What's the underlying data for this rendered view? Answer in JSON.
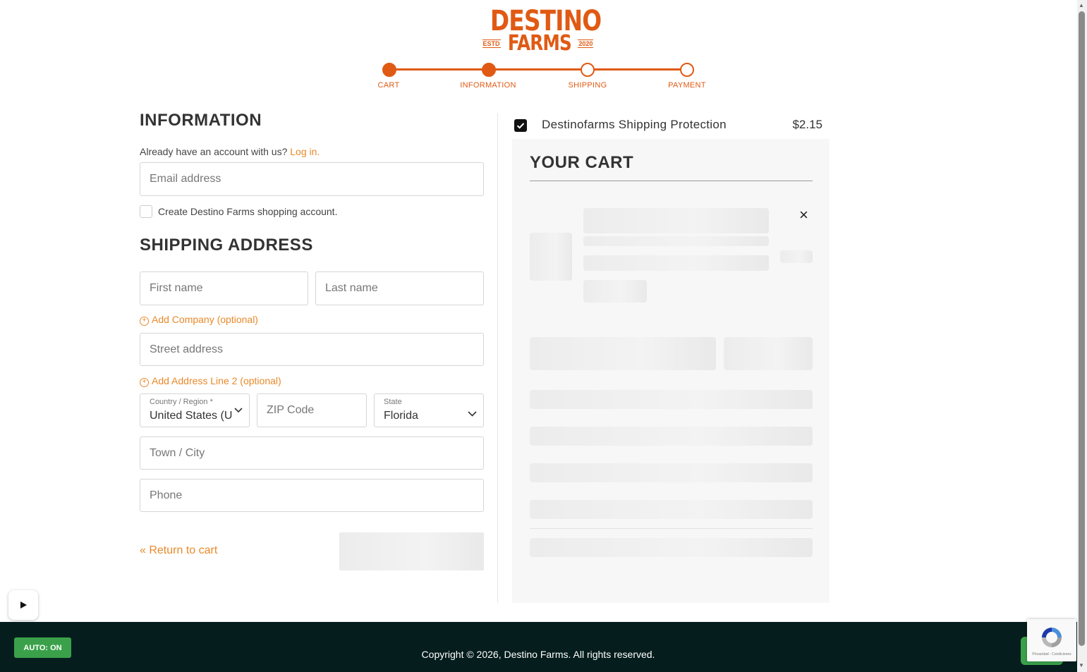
{
  "brand": {
    "line1": "DESTINO",
    "line2": "FARMS",
    "estd": "ESTD",
    "year": "2020",
    "color": "#e05a14"
  },
  "steps": [
    "CART",
    "INFORMATION",
    "SHIPPING",
    "PAYMENT"
  ],
  "info": {
    "heading": "INFORMATION",
    "account_prompt": "Already have an account with us?",
    "login_link": "Log in.",
    "email_placeholder": "Email address",
    "create_account_label": "Create Destino Farms shopping account."
  },
  "shipping": {
    "heading": "SHIPPING ADDRESS",
    "first_name": "First name",
    "last_name": "Last name",
    "add_company": "Add Company (optional)",
    "street": "Street address",
    "add_line2": "Add Address Line 2 (optional)",
    "country_label": "Country / Region *",
    "country_value": "United States (U",
    "zip": "ZIP Code",
    "state_label": "State",
    "state_value": "Florida",
    "city": "Town / City",
    "phone": "Phone",
    "return_link": "« Return to cart"
  },
  "cart": {
    "protection_label": "Destinofarms Shipping Protection",
    "protection_price": "$2.15",
    "heading": "YOUR CART",
    "remove_icon": "×"
  },
  "footer": {
    "copyright": "Copyright © 2026, Destino Farms. All rights reserved.",
    "auto_badge": "AUTO: ON",
    "recaptcha_text": "Privacidad - Condiciones"
  }
}
